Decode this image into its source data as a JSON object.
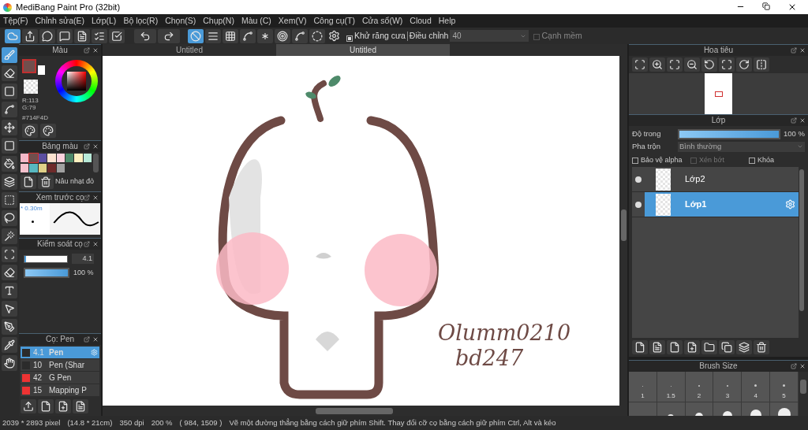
{
  "window": {
    "title": "MediBang Paint Pro (32bit)"
  },
  "menu": [
    "Tệp(F)",
    "Chỉnh sửa(E)",
    "Lớp(L)",
    "Bộ lọc(R)",
    "Chọn(S)",
    "Chụp(N)",
    "Màu (C)",
    "Xem(V)",
    "Công cụ(T)",
    "Cửa sổ(W)",
    "Cloud",
    "Help"
  ],
  "toolbar": {
    "snaps": [
      {
        "selected": true
      },
      {
        "selected": false
      },
      {
        "selected": false
      },
      {
        "selected": false
      },
      {
        "selected": false
      },
      {
        "selected": false
      },
      {
        "selected": false
      },
      {
        "selected": false
      }
    ],
    "antialias": {
      "label": "Khử răng cưa",
      "checked": true
    },
    "adjust_label": "Điều chỉnh",
    "adjust_value": "40",
    "soft_edge": {
      "label": "Cạnh mềm",
      "checked": false
    }
  },
  "tools": [
    {
      "selected": true
    },
    {
      "selected": false
    },
    {
      "selected": false
    },
    {
      "selected": false
    },
    {
      "selected": false
    },
    {
      "selected": false
    },
    {
      "selected": false
    },
    {
      "selected": false
    },
    {
      "selected": false
    },
    {
      "selected": false
    },
    {
      "selected": false
    },
    {
      "selected": false
    },
    {
      "selected": false
    },
    {
      "selected": false
    },
    {
      "selected": false
    },
    {
      "selected": false
    },
    {
      "selected": false
    },
    {
      "selected": false
    }
  ],
  "color_panel": {
    "title": "Màu",
    "color": "#714f4d",
    "r": "R:113",
    "g": "G:79",
    "hex": "#714F4D"
  },
  "palette_panel": {
    "title": "Bảng màu",
    "name": "Nâu nhạt đỏ",
    "swatches": [
      {
        "color": "#f4b8c8",
        "selected": false
      },
      {
        "color": "#714f4d",
        "selected": true
      },
      {
        "color": "#5c4fa0",
        "selected": false
      },
      {
        "color": "#fde3d0",
        "selected": false
      },
      {
        "color": "#fbd3de",
        "selected": false
      },
      {
        "color": "#4e8a6a",
        "selected": false
      },
      {
        "color": "#fdf0c0",
        "selected": false
      },
      {
        "color": "#b8ead8",
        "selected": false
      },
      {
        "color": "#f4c0cc",
        "selected": false
      },
      {
        "color": "#58b8c0",
        "selected": false
      },
      {
        "color": "#e0d088",
        "selected": false
      },
      {
        "color": "#6e2a2a",
        "selected": false
      },
      {
        "color": "#a0a0a0",
        "selected": false
      }
    ]
  },
  "brush_preview": {
    "title": "Xem trước cọ",
    "size": "* 0.30m"
  },
  "brush_control": {
    "title": "Kiểm soát cọ",
    "size_slider": {
      "level": 0.04
    },
    "size": "4.1",
    "opacity_slider": {
      "level": 1
    },
    "opacity": "100 %"
  },
  "brush_list": {
    "title": "Cọ: Pen",
    "items": [
      {
        "color": "#2b2b2b",
        "size": "4.1",
        "name": "Pen",
        "selected": true
      },
      {
        "color": "#2b2b2b",
        "size": "10",
        "name": "Pen (Shar",
        "selected": false
      },
      {
        "color": "#ee3333",
        "size": "42",
        "name": "G Pen",
        "selected": false
      },
      {
        "color": "#ee3333",
        "size": "15",
        "name": "Mapping P",
        "selected": false
      }
    ]
  },
  "canvas_tabs": [
    {
      "label": "Untitled",
      "selected": false
    },
    {
      "label": "Untitled",
      "selected": true
    }
  ],
  "canvas": {
    "signature": [
      "Olumm0210",
      "bd247"
    ]
  },
  "navigator": {
    "title": "Hoa tiêu"
  },
  "layers_panel": {
    "title": "Lớp",
    "opacity_label": "Độ trong",
    "opacity_slider": {
      "level": 1
    },
    "opacity": "100 %",
    "blend_label": "Pha trộn",
    "blend": "Bình thường",
    "options": [
      {
        "label": "Bảo vệ alpha",
        "checked": false,
        "disabled": false
      },
      {
        "label": "Xén bớt",
        "checked": false,
        "disabled": true
      },
      {
        "label": "Khóa",
        "checked": false,
        "disabled": false
      }
    ],
    "layers": [
      {
        "name": "Lớp2",
        "selected": false
      },
      {
        "name": "Lớp1",
        "selected": true
      }
    ]
  },
  "brush_size": {
    "title": "Brush Size",
    "sizes": [
      "1",
      "1.5",
      "2",
      "3",
      "4",
      "5"
    ]
  },
  "status_bar": [
    "2039 * 2893 pixel",
    "(14.8 * 21cm)",
    "350 dpi",
    "200 %",
    "( 984, 1509 )",
    "Vẽ một đường thẳng bằng cách giữ phím Shift. Thay đổi cỡ cọ bằng cách giữ phím Ctrl, Alt và kéo"
  ]
}
